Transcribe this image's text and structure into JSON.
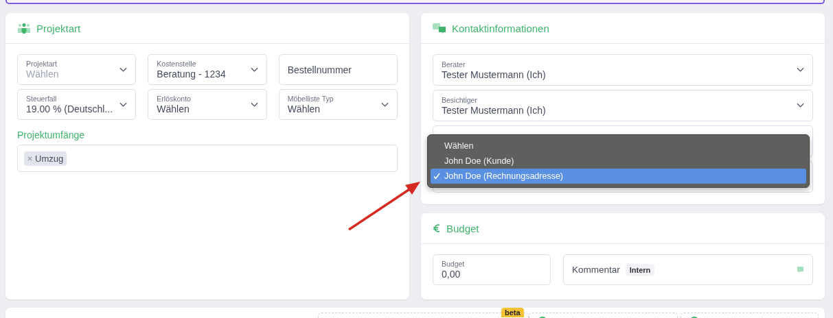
{
  "projektart": {
    "title": "Projektart",
    "fields": [
      {
        "kind": "select",
        "label": "Projektart",
        "placeholder": "Wählen"
      },
      {
        "kind": "select",
        "label": "Kostenstelle",
        "value": "Beratung - 1234"
      },
      {
        "kind": "input",
        "placeholder": "Bestellnummer"
      },
      {
        "kind": "select",
        "label": "Steuerfall",
        "value": "19.00 % (Deutschl..."
      },
      {
        "kind": "select",
        "label": "Erlöskonto",
        "value": "Wählen"
      },
      {
        "kind": "select",
        "label": "Möbelliste Typ",
        "value": "Wählen"
      }
    ],
    "scopes": {
      "title": "Projektumfänge",
      "tags": [
        {
          "label": "Umzug"
        }
      ]
    }
  },
  "kontakt": {
    "title": "Kontaktinformationen",
    "fields": [
      {
        "kind": "select",
        "label": "Berater",
        "value": "Tester Mustermann (Ich)"
      },
      {
        "kind": "select",
        "label": "Besichtiger",
        "value": "Tester Mustermann (Ich)"
      },
      {
        "kind": "select"
      },
      {
        "kind": "select"
      }
    ],
    "dropdown": {
      "options": [
        {
          "label": "Wählen",
          "selected": false
        },
        {
          "label": "John Doe (Kunde)",
          "selected": false
        },
        {
          "label": "John Doe (Rechnungsadresse)",
          "selected": true
        }
      ]
    }
  },
  "budget": {
    "title": "Budget",
    "field": {
      "label": "Budget",
      "value": "0,00"
    },
    "comment": {
      "label": "Kommentar",
      "badge": "Intern"
    }
  },
  "bottom": {
    "badge": "beta"
  }
}
